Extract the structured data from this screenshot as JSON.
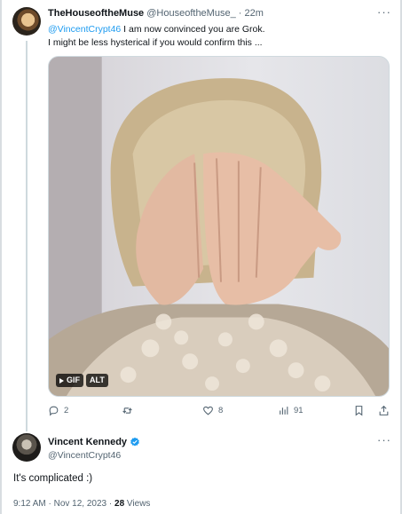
{
  "reply": {
    "author_name": "TheHouseoftheMuse",
    "author_handle": "@HouseoftheMuse_",
    "separator": "·",
    "time": "22m",
    "more": "···",
    "mention": "@VincentCrypt46",
    "text_line1": " I am now convinced you are Grok.",
    "text_line2": "I might be less hysterical if you would confirm this ...",
    "media": {
      "gif_label": "GIF",
      "alt_label": "ALT"
    },
    "actions": {
      "reply_count": "2",
      "retweet_count": "",
      "like_count": "8",
      "views_count": "91"
    }
  },
  "main": {
    "author_name": "Vincent Kennedy",
    "author_handle": "@VincentCrypt46",
    "more": "···",
    "text": "It's complicated :)",
    "time": "9:12 AM",
    "separator": "·",
    "date": "Nov 12, 2023",
    "views_number": "28",
    "views_label": "Views"
  },
  "colors": {
    "link": "#1d9bf0",
    "secondary_text": "#536471",
    "verified": "#1d9bf0"
  }
}
